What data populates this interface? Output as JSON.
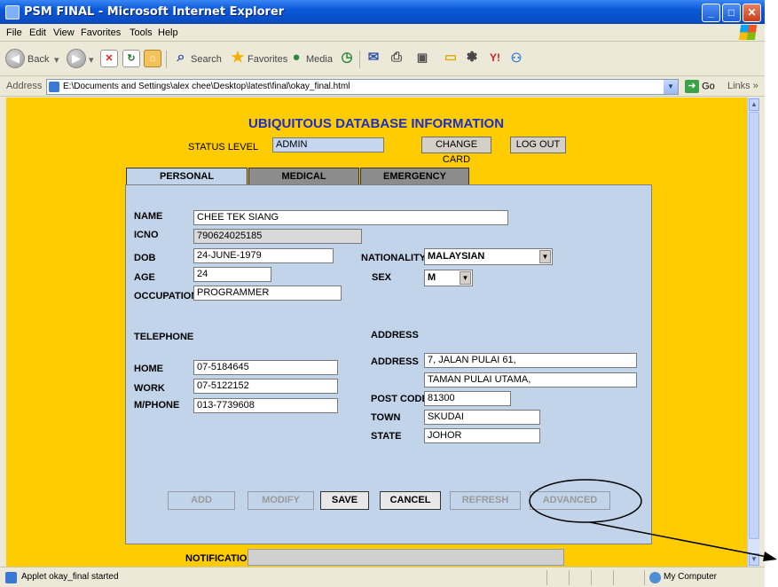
{
  "window": {
    "title": "PSM FINAL - Microsoft Internet Explorer",
    "buttons": {
      "minimize": "_",
      "maximize": "□",
      "close": "✕"
    }
  },
  "menu": [
    "File",
    "Edit",
    "View",
    "Favorites",
    "Tools",
    "Help"
  ],
  "toolbar": {
    "back": "Back",
    "search": "Search",
    "favorites": "Favorites",
    "media": "Media"
  },
  "address": {
    "label": "Address",
    "url": "E:\\Documents and Settings\\alex chee\\Desktop\\latest\\final\\okay_final.html",
    "go": "Go",
    "links": "Links"
  },
  "app": {
    "heading": "UBIQUITOUS DATABASE INFORMATION",
    "status_label": "STATUS LEVEL",
    "status_value": "ADMIN",
    "change_card": "CHANGE CARD",
    "logout": "LOG OUT",
    "tabs": [
      "PERSONAL INFORMATION",
      "MEDICAL INFORMATION",
      "EMERGENCY CONTACT"
    ],
    "fields": {
      "name_label": "NAME",
      "name": "CHEE TEK SIANG",
      "icno_label": "ICNO",
      "icno": "790624025185",
      "dob_label": "DOB",
      "dob": "24-JUNE-1979",
      "age_label": "AGE",
      "age": "24",
      "occupation_label": "OCCUPATION",
      "occupation": "PROGRAMMER",
      "nationality_label": "NATIONALITY",
      "nationality": "MALAYSIAN",
      "sex_label": "SEX",
      "sex": "M"
    },
    "telephone": {
      "section": "TELEPHONE",
      "home_label": "HOME",
      "home": "07-5184645",
      "work_label": "WORK",
      "work": "07-5122152",
      "mphone_label": "M/PHONE",
      "mphone": "013-7739608"
    },
    "address": {
      "section": "ADDRESS",
      "address_label": "ADDRESS",
      "line1": "7, JALAN PULAI 61,",
      "line2": "TAMAN PULAI UTAMA,",
      "postcode_label": "POST CODE",
      "postcode": "81300",
      "town_label": "TOWN",
      "town": "SKUDAI",
      "state_label": "STATE",
      "state": "JOHOR"
    },
    "actions": {
      "add": "ADD",
      "modify": "MODIFY",
      "save": "SAVE",
      "cancel": "CANCEL",
      "refresh": "REFRESH",
      "advanced": "ADVANCED"
    },
    "notification_label": "NOTIFICATION",
    "notification": ""
  },
  "status": {
    "text": "Applet okay_final started",
    "zone": "My Computer"
  }
}
